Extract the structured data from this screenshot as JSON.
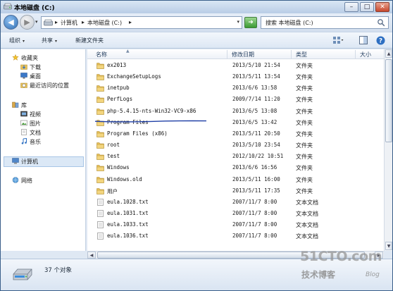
{
  "window": {
    "title": "本地磁盘 (C:)",
    "minimize": "–",
    "maximize": "□",
    "close": "✕"
  },
  "address": {
    "separator": "▸",
    "crumbs": [
      "计算机",
      "本地磁盘 (C:)"
    ],
    "dropdown": "▾",
    "search_placeholder": "搜索 本地磁盘 (C:)"
  },
  "toolbar": {
    "organize": "组织",
    "share": "共享",
    "new_folder": "新建文件夹",
    "arrow": "▾"
  },
  "nav": {
    "favorites": "收藏夹",
    "downloads": "下载",
    "desktop": "桌面",
    "recent": "最近访问的位置",
    "libraries": "库",
    "videos": "视频",
    "pictures": "图片",
    "documents": "文档",
    "music": "音乐",
    "computer": "计算机",
    "network": "网络"
  },
  "columns": {
    "name": "名称",
    "date": "修改日期",
    "type": "类型",
    "size": "大小"
  },
  "files": [
    {
      "name": "ex2013",
      "date": "2013/5/10 21:54",
      "type": "文件夹",
      "kind": "folder"
    },
    {
      "name": "ExchangeSetupLogs",
      "date": "2013/5/11 13:54",
      "type": "文件夹",
      "kind": "folder"
    },
    {
      "name": "inetpub",
      "date": "2013/6/6 13:58",
      "type": "文件夹",
      "kind": "folder"
    },
    {
      "name": "PerfLogs",
      "date": "2009/7/14 11:20",
      "type": "文件夹",
      "kind": "folder"
    },
    {
      "name": "php-5.4.15-nts-Win32-VC9-x86",
      "date": "2013/6/5 13:08",
      "type": "文件夹",
      "kind": "folder"
    },
    {
      "name": "Program Files",
      "date": "2013/6/5 13:42",
      "type": "文件夹",
      "kind": "folder"
    },
    {
      "name": "Program Files (x86)",
      "date": "2013/5/11 20:50",
      "type": "文件夹",
      "kind": "folder"
    },
    {
      "name": "root",
      "date": "2013/5/10 23:54",
      "type": "文件夹",
      "kind": "folder"
    },
    {
      "name": "test",
      "date": "2012/10/22 10:51",
      "type": "文件夹",
      "kind": "folder"
    },
    {
      "name": "Windows",
      "date": "2013/6/6 16:56",
      "type": "文件夹",
      "kind": "folder"
    },
    {
      "name": "Windows.old",
      "date": "2013/5/11 16:00",
      "type": "文件夹",
      "kind": "folder"
    },
    {
      "name": "用户",
      "date": "2013/5/11 17:35",
      "type": "文件夹",
      "kind": "folder"
    },
    {
      "name": "eula.1028.txt",
      "date": "2007/11/7 8:00",
      "type": "文本文档",
      "kind": "text"
    },
    {
      "name": "eula.1031.txt",
      "date": "2007/11/7 8:00",
      "type": "文本文档",
      "kind": "text"
    },
    {
      "name": "eula.1033.txt",
      "date": "2007/11/7 8:00",
      "type": "文本文档",
      "kind": "text"
    },
    {
      "name": "eula.1036.txt",
      "date": "2007/11/7 8:00",
      "type": "文本文档",
      "kind": "text"
    }
  ],
  "scroll": {
    "up": "▲",
    "down": "▼",
    "left": "◀",
    "right": "▶"
  },
  "status": {
    "count_text": "37 个对象"
  },
  "watermark": {
    "logo": "51CTO.com",
    "sub": "技术博客",
    "blog": "Blog"
  },
  "colors": {
    "folder": "#e8c15a",
    "selection": "#dbe8f6",
    "annotation": "#1f3fa6"
  }
}
